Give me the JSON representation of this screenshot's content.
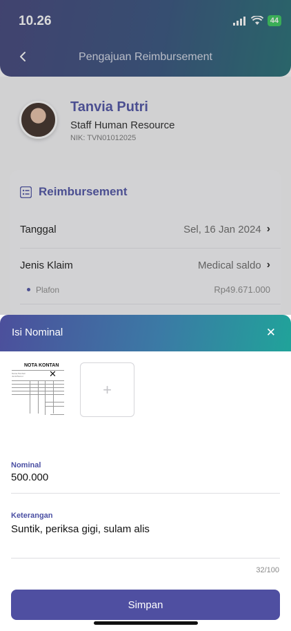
{
  "status_bar": {
    "time": "10.26",
    "battery": "44"
  },
  "header": {
    "title": "Pengajuan Reimbursement"
  },
  "profile": {
    "name": "Tanvia Putri",
    "role": "Staff Human Resource",
    "nik": "NIK: TVN01012025"
  },
  "reimbursement": {
    "section_title": "Reimbursement",
    "tanggal": {
      "label": "Tanggal",
      "value": "Sel, 16 Jan 2024"
    },
    "jenis_klaim": {
      "label": "Jenis Klaim",
      "value": "Medical saldo"
    },
    "plafon": {
      "label": "Plafon",
      "value": "Rp49.671.000"
    }
  },
  "sheet": {
    "title": "Isi Nominal",
    "receipt_title": "NOTA KONTAN",
    "nominal": {
      "label": "Nominal",
      "value": "500.000"
    },
    "keterangan": {
      "label": "Keterangan",
      "value": "Suntik, periksa gigi, sulam alis",
      "counter": "32/100"
    },
    "save_label": "Simpan"
  },
  "colors": {
    "accent": "#4a4fa3",
    "button": "#4f4fa1",
    "battery": "#34c759"
  }
}
